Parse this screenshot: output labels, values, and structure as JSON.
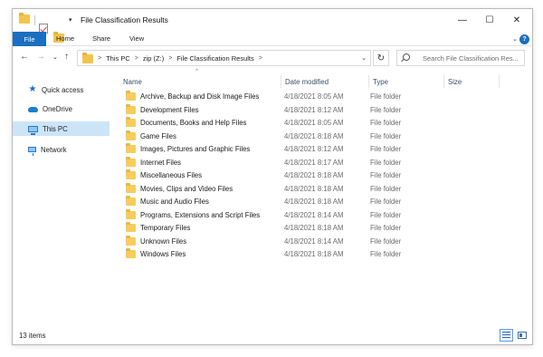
{
  "window": {
    "title": "File Classification Results",
    "controls": {
      "minimize": "—",
      "maximize": "☐",
      "close": "✕"
    }
  },
  "quick_access_toolbar": {
    "icons": [
      "folder-icon",
      "properties-checkmark-icon",
      "new-folder-icon"
    ],
    "dropdown": "▾"
  },
  "ribbon": {
    "file": "File",
    "tabs": [
      "Home",
      "Share",
      "View"
    ],
    "expand": "⌄",
    "help": "?"
  },
  "address": {
    "back": "←",
    "forward": "→",
    "recent": "⌄",
    "up": "↑",
    "crumbs": [
      "This PC",
      "zip (Z:)",
      "File Classification Results"
    ],
    "crumb_separator": ">",
    "dropdown": "⌄",
    "refresh": "↻"
  },
  "search": {
    "placeholder": "Search File Classification Res..."
  },
  "sidebar": {
    "items": [
      {
        "label": "Quick access",
        "icon": "star-icon",
        "selected": false
      },
      {
        "label": "OneDrive",
        "icon": "cloud-icon",
        "selected": false
      },
      {
        "label": "This PC",
        "icon": "computer-icon",
        "selected": true
      },
      {
        "label": "Network",
        "icon": "network-icon",
        "selected": false
      }
    ]
  },
  "columns": {
    "sort_indicator": "^",
    "headers": [
      "Name",
      "Date modified",
      "Type",
      "Size"
    ]
  },
  "files": [
    {
      "name": "Archive, Backup and Disk Image Files",
      "date": "4/18/2021 8:05 AM",
      "type": "File folder"
    },
    {
      "name": "Development Files",
      "date": "4/18/2021 8:12 AM",
      "type": "File folder"
    },
    {
      "name": "Documents, Books and Help Files",
      "date": "4/18/2021 8:05 AM",
      "type": "File folder"
    },
    {
      "name": "Game Files",
      "date": "4/18/2021 8:18 AM",
      "type": "File folder"
    },
    {
      "name": "Images, Pictures and Graphic Files",
      "date": "4/18/2021 8:12 AM",
      "type": "File folder"
    },
    {
      "name": "Internet Files",
      "date": "4/18/2021 8:17 AM",
      "type": "File folder"
    },
    {
      "name": "Miscellaneous Files",
      "date": "4/18/2021 8:18 AM",
      "type": "File folder"
    },
    {
      "name": "Movies, Clips and Video Files",
      "date": "4/18/2021 8:18 AM",
      "type": "File folder"
    },
    {
      "name": "Music and Audio Files",
      "date": "4/18/2021 8:18 AM",
      "type": "File folder"
    },
    {
      "name": "Programs, Extensions and Script Files",
      "date": "4/18/2021 8:14 AM",
      "type": "File folder"
    },
    {
      "name": "Temporary Files",
      "date": "4/18/2021 8:18 AM",
      "type": "File folder"
    },
    {
      "name": "Unknown Files",
      "date": "4/18/2021 8:14 AM",
      "type": "File folder"
    },
    {
      "name": "Windows Files",
      "date": "4/18/2021 8:18 AM",
      "type": "File folder"
    }
  ],
  "status": {
    "item_count": "13 items"
  },
  "colors": {
    "accent": "#1a6fc0",
    "selection": "#cce4f7",
    "folder": "#f6cd5c"
  }
}
